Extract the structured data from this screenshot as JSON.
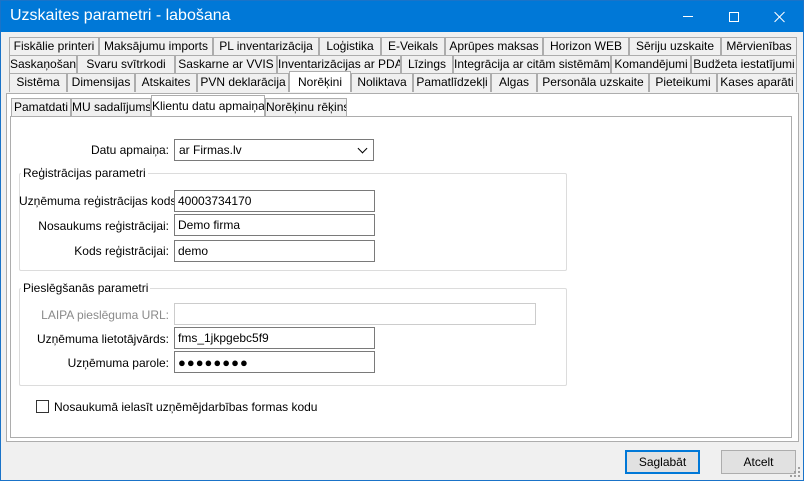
{
  "window": {
    "title": "Uzskaites parametri - labošana"
  },
  "tabs_row1": [
    "Fiskālie printeri",
    "Maksājumu imports",
    "PL inventarizācija",
    "Loģistika",
    "E-Veikals",
    "Aprūpes maksas",
    "Horizon WEB",
    "Sēriju uzskaite",
    "Mērvienības"
  ],
  "tabs_row2": [
    "Saskaņošana",
    "Svaru svītrkodi",
    "Saskarne ar VVIS",
    "Inventarizācijas ar PDA",
    "Līzings",
    "Integrācija ar citām sistēmām",
    "Komandējumi",
    "Budžeta iestatījumi"
  ],
  "tabs_row3": [
    "Sistēma",
    "Dimensijas",
    "Atskaites",
    "PVN deklarācija",
    "Norēķini",
    "Noliktava",
    "Pamatlīdzekļi",
    "Algas",
    "Personāla uzskaite",
    "Pieteikumi",
    "Kases aparāti"
  ],
  "tabs_row3_selected": "Norēķini",
  "subtabs": [
    "Pamatdati",
    "MU sadalījums",
    "Klientu datu apmaiņa",
    "Norēķinu rēķins"
  ],
  "subtabs_selected": "Klientu datu apmaiņa",
  "form": {
    "datu_apmaina_label": "Datu apmaiņa:",
    "datu_apmaina_value": "ar Firmas.lv",
    "registracijas_group": "Reģistrācijas parametri",
    "reg_kods_label": "Uzņēmuma reģistrācijas kods:",
    "reg_kods_value": "40003734170",
    "nosaukums_label": "Nosaukums reģistrācijai:",
    "nosaukums_value": "Demo firma",
    "kods_label": "Kods reģistrācijai:",
    "kods_value": "demo",
    "pieslegsanas_group": "Pieslēgšanās parametri",
    "laipa_label": "LAIPA pieslēguma URL:",
    "laipa_value": "",
    "lietotajvards_label": "Uzņēmuma lietotājvārds:",
    "lietotajvards_value": "fms_1jkpgebc5f9",
    "parole_label": "Uzņēmuma parole:",
    "parole_value": "●●●●●●●●",
    "checkbox_label": "Nosaukumā ielasīt uzņēmējdarbības formas kodu",
    "checkbox_checked": false
  },
  "buttons": {
    "save": "Saglabāt",
    "cancel": "Atcelt"
  },
  "colors": {
    "titlebar": "#0078d7",
    "default_button_border": "#0078d7"
  }
}
